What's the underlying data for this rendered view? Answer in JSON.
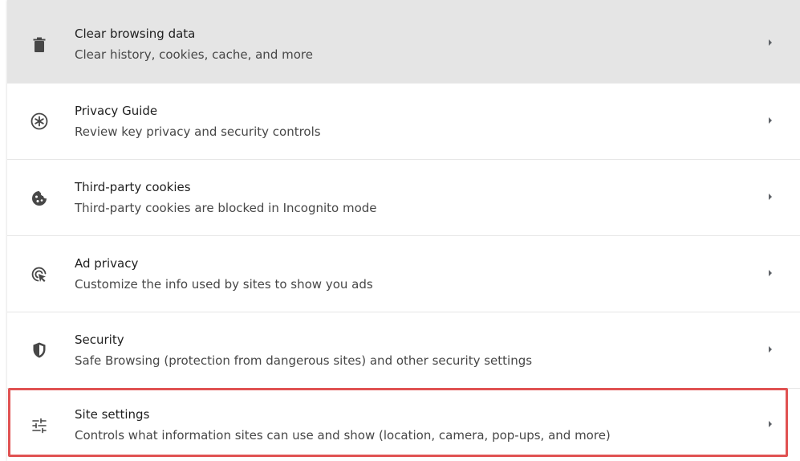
{
  "privacy_settings": {
    "items": [
      {
        "title": "Clear browsing data",
        "subtitle": "Clear history, cookies, cache, and more",
        "icon": "trash-icon"
      },
      {
        "title": "Privacy Guide",
        "subtitle": "Review key privacy and security controls",
        "icon": "privacy-guide-icon"
      },
      {
        "title": "Third-party cookies",
        "subtitle": "Third-party cookies are blocked in Incognito mode",
        "icon": "cookie-icon"
      },
      {
        "title": "Ad privacy",
        "subtitle": "Customize the info used by sites to show you ads",
        "icon": "ad-privacy-icon"
      },
      {
        "title": "Security",
        "subtitle": "Safe Browsing (protection from dangerous sites) and other security settings",
        "icon": "shield-icon"
      },
      {
        "title": "Site settings",
        "subtitle": "Controls what information sites can use and show (location, camera, pop-ups, and more)",
        "icon": "sliders-icon"
      }
    ]
  },
  "colors": {
    "hover_row_background": "#e5e5e5",
    "highlight_border": "#e05252",
    "icon_color": "#474747"
  }
}
